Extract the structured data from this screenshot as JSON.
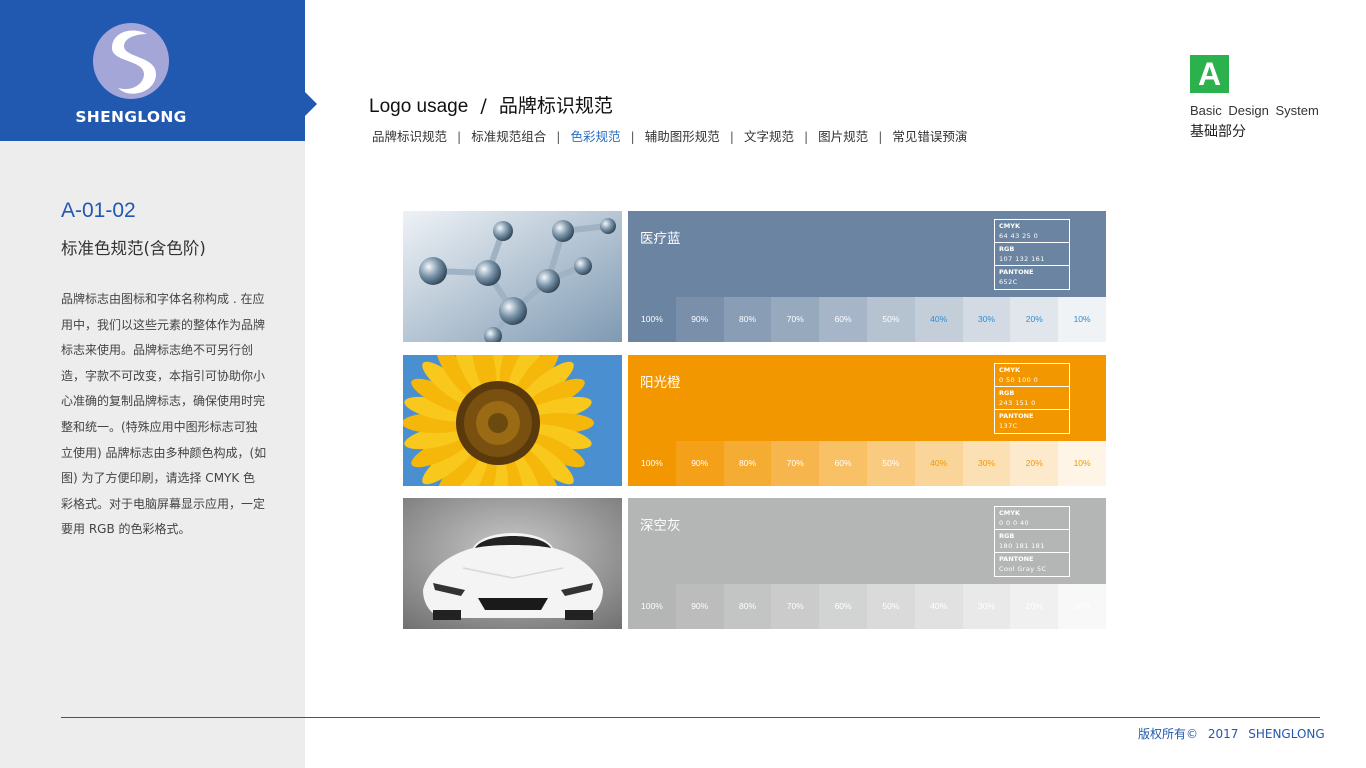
{
  "brand": {
    "name": "SHENGLONG",
    "primary_color": "#2158b0"
  },
  "header": {
    "title_en": "Logo usage",
    "title_sep": "/",
    "title_cn": "品牌标识规范",
    "nav": [
      {
        "label": "品牌标识规范",
        "active": false
      },
      {
        "label": "标准规范组合",
        "active": false
      },
      {
        "label": "色彩规范",
        "active": true
      },
      {
        "label": "辅助图形规范",
        "active": false
      },
      {
        "label": "文字规范",
        "active": false
      },
      {
        "label": "图片规范",
        "active": false
      },
      {
        "label": "常见错误预演",
        "active": false
      }
    ],
    "nav_separator": "|"
  },
  "badge": {
    "letter": "A",
    "label_en": "Basic  Design  System",
    "label_cn": "基础部分",
    "color": "#2bb24c"
  },
  "section": {
    "code": "A-01-02",
    "title": "标准色规范(含色阶)",
    "description": "品牌标志由图标和字体名称构成 . 在应用中，我们以这些元素的整体作为品牌标志来使用。品牌标志绝不可另行创造，字款不可改变，本指引可协助你小心准确的复制品牌标志，确保使用时完整和统一。(特殊应用中图形标志可独立使用) 品牌标志由多种颜色构成，(如图) 为了方便印刷，请选择 CMYK 色彩格式。对于电脑屏幕显示应用，一定要用 RGB 的色彩格式。"
  },
  "colors": [
    {
      "name": "医疗蓝",
      "hex": "#6b84a1",
      "image": "molecule",
      "cmyk_label": "CMYK",
      "cmyk": "64 43 25 0",
      "rgb_label": "RGB",
      "rgb": "107 132 161",
      "pantone_label": "PANTONE",
      "pantone": "652C",
      "tints": [
        "100%",
        "90%",
        "80%",
        "70%",
        "60%",
        "50%",
        "40%",
        "30%",
        "20%",
        "10%"
      ]
    },
    {
      "name": "阳光橙",
      "hex": "#f39700",
      "image": "sunflower",
      "cmyk_label": "CMYK",
      "cmyk": "0 50 100 0",
      "rgb_label": "RGB",
      "rgb": "243 151 0",
      "pantone_label": "PANTONE",
      "pantone": "137C",
      "tints": [
        "100%",
        "90%",
        "80%",
        "70%",
        "60%",
        "50%",
        "40%",
        "30%",
        "20%",
        "10%"
      ]
    },
    {
      "name": "深空灰",
      "hex": "#b4b5b5",
      "image": "sports-car",
      "cmyk_label": "CMYK",
      "cmyk": "0 0 0 40",
      "rgb_label": "RGB",
      "rgb": "180 181 181",
      "pantone_label": "PANTONE",
      "pantone": "Cool Gray 5C",
      "tints": [
        "100%",
        "90%",
        "80%",
        "70%",
        "60%",
        "50%",
        "40%",
        "30%",
        "20%",
        "10%"
      ]
    }
  ],
  "footer": {
    "copyright": "版权所有©",
    "year": "2017",
    "company": "SHENGLONG"
  }
}
